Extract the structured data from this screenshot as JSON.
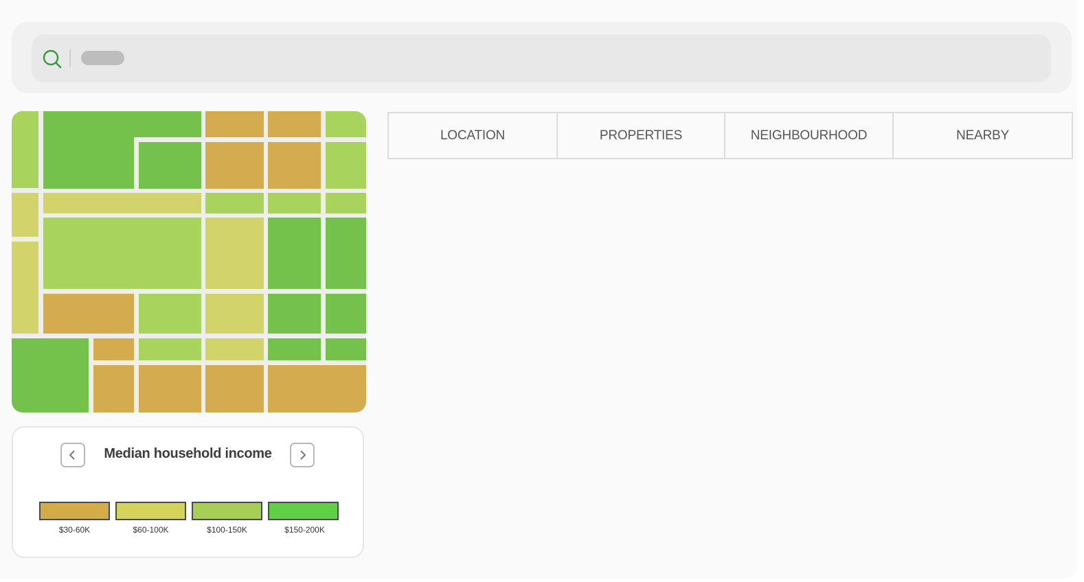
{
  "search": {
    "placeholder": "",
    "value": ""
  },
  "icons": {
    "search": "search-icon",
    "prev": "chevron-left-icon",
    "next": "chevron-right-icon"
  },
  "tabs": [
    {
      "label": "LOCATION"
    },
    {
      "label": "PROPERTIES"
    },
    {
      "label": "NEIGHBOURHOOD"
    },
    {
      "label": "NEARBY"
    }
  ],
  "legend": {
    "title": "Median household income",
    "items": [
      {
        "label": "$30-60K",
        "color": "#d4ac47"
      },
      {
        "label": "$60-100K",
        "color": "#d4d35a"
      },
      {
        "label": "$100-150K",
        "color": "#a5d055"
      },
      {
        "label": "$150-200K",
        "color": "#5fd046"
      }
    ]
  },
  "colors": {
    "accent": "#2e9b3a",
    "map_low": "#d4ac4f",
    "map_mid_low": "#d2d36b",
    "map_mid_high": "#a8d35c",
    "map_high": "#74c24c"
  }
}
